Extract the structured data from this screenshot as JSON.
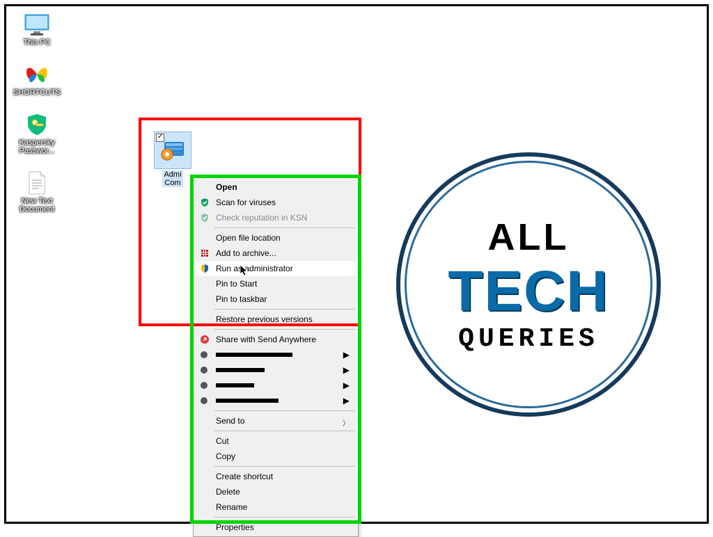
{
  "desktop": {
    "icons": [
      {
        "name": "this-pc",
        "label": "This PC"
      },
      {
        "name": "shortcuts",
        "label": "SHORTCUTS"
      },
      {
        "name": "kaspersky",
        "label": "Kaspersky Passwor..."
      },
      {
        "name": "new-text",
        "label": "New Text Document"
      }
    ],
    "selected_icon": {
      "label": "Admi\nCom"
    }
  },
  "context_menu": {
    "open": "Open",
    "scan": "Scan for viruses",
    "ksn": "Check reputation in KSN",
    "open_loc": "Open file location",
    "archive": "Add to archive...",
    "run_admin": "Run as administrator",
    "pin_start": "Pin to Start",
    "pin_taskbar": "Pin to taskbar",
    "restore": "Restore previous versions",
    "share": "Share with Send Anywhere",
    "send_to": "Send to",
    "cut": "Cut",
    "copy": "Copy",
    "shortcut": "Create shortcut",
    "delete": "Delete",
    "rename": "Rename",
    "properties": "Properties"
  },
  "logo": {
    "line1": "ALL",
    "line2": "TECH",
    "line3": "QUERIES"
  }
}
